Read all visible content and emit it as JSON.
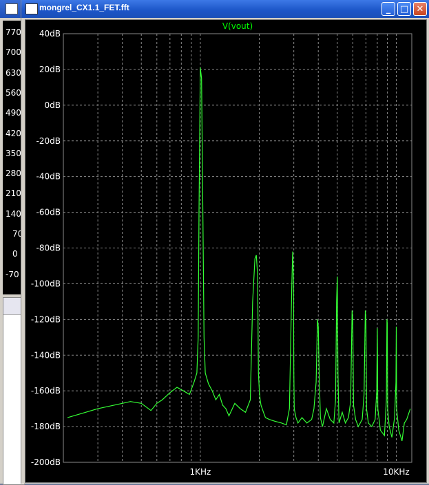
{
  "window": {
    "title": "mongrel_CX1.1_FET.fft",
    "buttons": {
      "minimize": "_",
      "maximize": "□",
      "close": "✕"
    }
  },
  "background_window": {
    "y_labels": [
      "770",
      "700",
      "630",
      "560",
      "490",
      "420",
      "350",
      "280",
      "210",
      "140",
      "70",
      "0",
      "-70"
    ]
  },
  "colors": {
    "trace": "#34ff34",
    "grid": "#8a8a8a",
    "background": "#000000",
    "text": "#ffffff"
  },
  "chart_data": {
    "type": "line",
    "title": "V(vout)",
    "xscale": "log",
    "xlim": [
      200,
      12000
    ],
    "ylim": [
      -200,
      40
    ],
    "x_tick_labels": [
      {
        "x": 1000,
        "label": "1KHz"
      },
      {
        "x": 10000,
        "label": "10KHz"
      }
    ],
    "y_ticks": [
      40,
      20,
      0,
      -20,
      -40,
      -60,
      -80,
      -100,
      -120,
      -140,
      -160,
      -180,
      -200
    ],
    "y_tick_labels": [
      "40dB",
      "20dB",
      "0dB",
      "-20dB",
      "-40dB",
      "-60dB",
      "-80dB",
      "-100dB",
      "-120dB",
      "-140dB",
      "-160dB",
      "-180dB",
      "-200dB"
    ],
    "grid": true,
    "series": [
      {
        "x": [
          210,
          300,
          400,
          440,
          500,
          560,
          600,
          640,
          700,
          760,
          820,
          880,
          930,
          960,
          975,
          985,
          1000,
          1015,
          1030,
          1045,
          1060,
          1100,
          1150,
          1200,
          1250,
          1300,
          1350,
          1400,
          1500,
          1600,
          1700,
          1800,
          1850,
          1900,
          1930,
          1960,
          1980,
          2000,
          2020,
          2040,
          2070,
          2100,
          2150,
          2250,
          2400,
          2600,
          2750,
          2850,
          2930,
          2960,
          2985,
          3000,
          3015,
          3040,
          3080,
          3150,
          3300,
          3500,
          3700,
          3800,
          3900,
          3960,
          4000,
          4040,
          4100,
          4200,
          4400,
          4600,
          4800,
          4900,
          4960,
          5000,
          5040,
          5100,
          5300,
          5500,
          5700,
          5850,
          5950,
          6000,
          6050,
          6200,
          6400,
          6700,
          6850,
          6950,
          7000,
          7050,
          7200,
          7500,
          7800,
          7950,
          8000,
          8050,
          8300,
          8700,
          8900,
          8960,
          9000,
          9040,
          9200,
          9500,
          9800,
          9960,
          10000,
          10040,
          10300,
          10700,
          11000,
          11300,
          11800
        ],
        "y": [
          -175,
          -170,
          -167,
          -166,
          -167,
          -171,
          -167,
          -165,
          -161,
          -158,
          -160,
          -162,
          -155,
          -150,
          -130,
          -60,
          21,
          15,
          -60,
          -130,
          -150,
          -156,
          -160,
          -165,
          -162,
          -168,
          -170,
          -174,
          -167,
          -170,
          -172,
          -165,
          -110,
          -86,
          -84,
          -95,
          -150,
          -160,
          -165,
          -168,
          -170,
          -172,
          -175,
          -176,
          -177,
          -178,
          -179,
          -170,
          -100,
          -82,
          -95,
          -150,
          -170,
          -172,
          -175,
          -178,
          -175,
          -178,
          -176,
          -170,
          -155,
          -120,
          -124,
          -150,
          -175,
          -180,
          -170,
          -176,
          -178,
          -165,
          -110,
          -96,
          -150,
          -178,
          -172,
          -178,
          -175,
          -166,
          -115,
          -120,
          -168,
          -176,
          -180,
          -176,
          -162,
          -115,
          -120,
          -170,
          -178,
          -180,
          -176,
          -160,
          -125,
          -170,
          -182,
          -185,
          -165,
          -120,
          -122,
          -170,
          -180,
          -186,
          -175,
          -155,
          -124,
          -170,
          -182,
          -188,
          -178,
          -176,
          -170
        ]
      }
    ]
  }
}
